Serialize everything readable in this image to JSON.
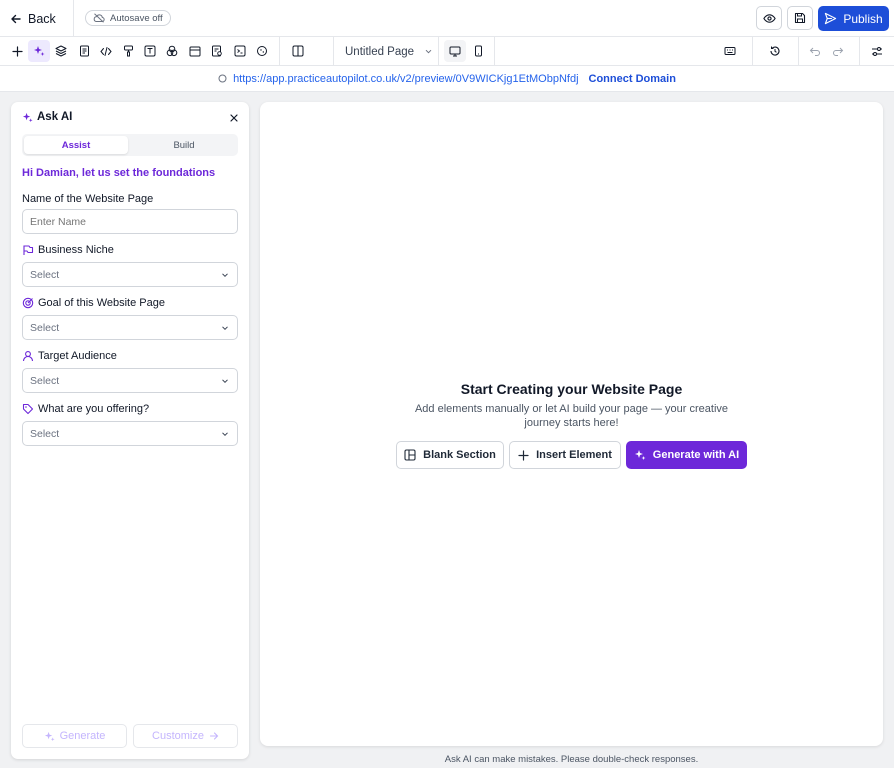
{
  "topbar": {
    "back_label": "Back",
    "autosave_label": "Autosave off",
    "publish_label": "Publish"
  },
  "toolbar": {
    "page_name": "Untitled Page"
  },
  "urlbar": {
    "url": "https://app.practiceautopilot.co.uk/v2/preview/0V9WICKjg1EtMObpNfdj",
    "connect_label": "Connect Domain"
  },
  "panel": {
    "title": "Ask AI",
    "tabs": [
      {
        "label": "Assist",
        "active": true
      },
      {
        "label": "Build",
        "active": false
      }
    ],
    "greeting": "Hi Damian, let us set the foundations",
    "fields": {
      "page_name": {
        "label": "Name of the Website Page",
        "placeholder": "Enter Name"
      },
      "niche": {
        "label": "Business Niche",
        "value": "Select"
      },
      "goal": {
        "label": "Goal of this Website Page",
        "value": "Select"
      },
      "audience": {
        "label": "Target Audience",
        "value": "Select"
      },
      "offering": {
        "label": "What are you offering?",
        "value": "Select"
      }
    },
    "generate_label": "Generate",
    "customize_label": "Customize"
  },
  "canvas": {
    "title": "Start Creating your Website Page",
    "description": "Add elements manually or let AI build your page — your creative journey starts here!",
    "blank_section_label": "Blank Section",
    "insert_element_label": "Insert Element",
    "generate_ai_label": "Generate with AI"
  },
  "disclaimer": "Ask AI can make mistakes. Please double-check responses.",
  "colors": {
    "accent": "#6d28d9",
    "primary": "#1d4ed8",
    "link": "#2563eb"
  }
}
